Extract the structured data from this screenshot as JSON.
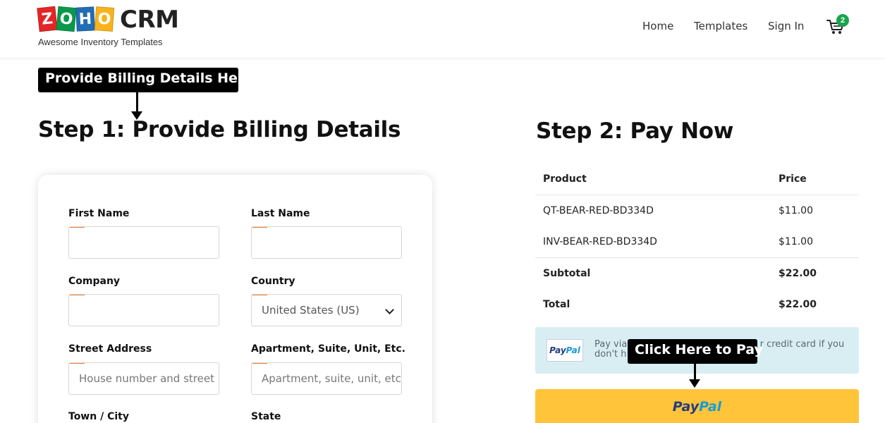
{
  "brand": {
    "logo_letters": [
      "Z",
      "O",
      "H",
      "O"
    ],
    "logo_product": "CRM",
    "tagline": "Awesome Inventory Templates",
    "colors": {
      "z": "#e42527",
      "o1": "#089949",
      "h": "#226db4",
      "o2": "#f9b21d"
    }
  },
  "nav": {
    "home": "Home",
    "templates": "Templates",
    "sign_in": "Sign In",
    "cart_icon": "cart-icon",
    "cart_count": "2"
  },
  "annotations": {
    "billing": "Provide Billing Details Here",
    "pay": "Click Here to Pay"
  },
  "step1": {
    "title": "Step 1: Provide Billing Details",
    "fields": {
      "first_name_label": "First Name",
      "first_name_value": "",
      "last_name_label": "Last Name",
      "last_name_value": "",
      "company_label": "Company",
      "company_value": "",
      "country_label": "Country",
      "country_value": "United States (US)",
      "street_label": "Street Address",
      "street_placeholder": "House number and street name",
      "apt_label": "Apartment, Suite, Unit, Etc.",
      "apt_placeholder": "Apartment, suite, unit, etc. (optional)",
      "town_label": "Town / City",
      "state_label": "State"
    }
  },
  "step2": {
    "title": "Step 2: Pay Now",
    "table": {
      "headers": [
        "Product",
        "Price"
      ],
      "rows": [
        {
          "product": "QT-BEAR-RED-BD334D",
          "price": "$11.00"
        },
        {
          "product": "INV-BEAR-RED-BD334D",
          "price": "$11.00"
        }
      ],
      "subtotal_label": "Subtotal",
      "subtotal_value": "$22.00",
      "total_label": "Total",
      "total_value": "$22.00"
    },
    "paypal_note_line1": "Pay via",
    "paypal_note_line1_end": "r credit card if you",
    "paypal_note_line2": "don't h",
    "paypal_logo_pay": "Pay",
    "paypal_logo_pal": "Pal",
    "paypal_button_pay": "Pay",
    "paypal_button_pal": "Pal",
    "button_color": "#ffc439"
  }
}
